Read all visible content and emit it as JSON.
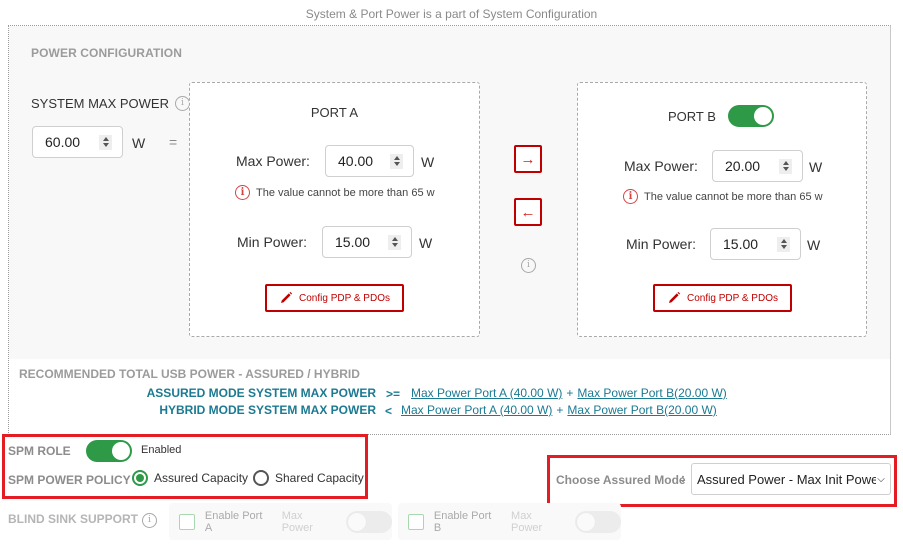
{
  "top_note": "System & Port Power is a part of System Configuration",
  "power_config": {
    "title": "POWER CONFIGURATION",
    "system_max_power": {
      "label": "SYSTEM MAX POWER",
      "info_icon": "info-icon",
      "value": "60.00",
      "unit": "W",
      "equals": "="
    },
    "port_a": {
      "title": "PORT A",
      "max_power_label": "Max Power:",
      "max_power_value": "40.00",
      "max_unit": "W",
      "error_icon": "error-info-icon",
      "error_text": "The value cannot be more than 65 w",
      "min_power_label": "Min Power:",
      "min_power_value": "15.00",
      "min_unit": "W",
      "config_button": "Config PDP & PDOs",
      "config_icon": "pencil-icon"
    },
    "port_b": {
      "title": "PORT B",
      "enabled": true,
      "max_power_label": "Max Power:",
      "max_power_value": "20.00",
      "max_unit": "W",
      "error_icon": "error-info-icon",
      "error_text": "The value cannot be more than 65 w",
      "min_power_label": "Min Power:",
      "min_power_value": "15.00",
      "min_unit": "W",
      "config_button": "Config PDP & PDOs",
      "config_icon": "pencil-icon"
    },
    "transfer": {
      "right_arrow": "→",
      "left_arrow": "←",
      "info_icon": "info-icon"
    }
  },
  "recommended": {
    "title": "RECOMMENDED TOTAL USB POWER - ASSURED / HYBRID",
    "rows": [
      {
        "label": "ASSURED MODE SYSTEM MAX POWER",
        "operator": ">=",
        "link_a": "Max Power Port A (40.00 W)",
        "plus": "+",
        "link_b": "Max Power Port B(20.00 W)"
      },
      {
        "label": "HYBRID MODE SYSTEM MAX POWER",
        "operator": "<",
        "link_a": "Max Power Port A (40.00 W)",
        "plus": "+",
        "link_b": "Max Power Port B(20.00 W)"
      }
    ]
  },
  "spm": {
    "role_label": "SPM ROLE",
    "role_enabled": true,
    "role_status": "Enabled",
    "policy_label": "SPM POWER POLICY",
    "policy_options": [
      {
        "label": "Assured Capacity",
        "selected": true
      },
      {
        "label": "Shared Capacity",
        "selected": false
      }
    ]
  },
  "assured_mode": {
    "label": "Choose Assured Mode",
    "colon": ":",
    "selected": "Assured Power - Max Init Power"
  },
  "blind_sink": {
    "label": "BLIND SINK SUPPORT",
    "info_icon": "info-icon",
    "ports": [
      {
        "checkbox_label": "Enable Port A",
        "toggle_label": "Max Power",
        "checked": false,
        "toggle_on": false
      },
      {
        "checkbox_label": "Enable Port B",
        "toggle_label": "Max Power",
        "checked": false,
        "toggle_on": false
      }
    ]
  },
  "colors": {
    "accent_red": "#c00000",
    "highlight_red": "#e41c23",
    "toggle_green": "#2e9a48",
    "link_teal": "#1b7a92"
  }
}
